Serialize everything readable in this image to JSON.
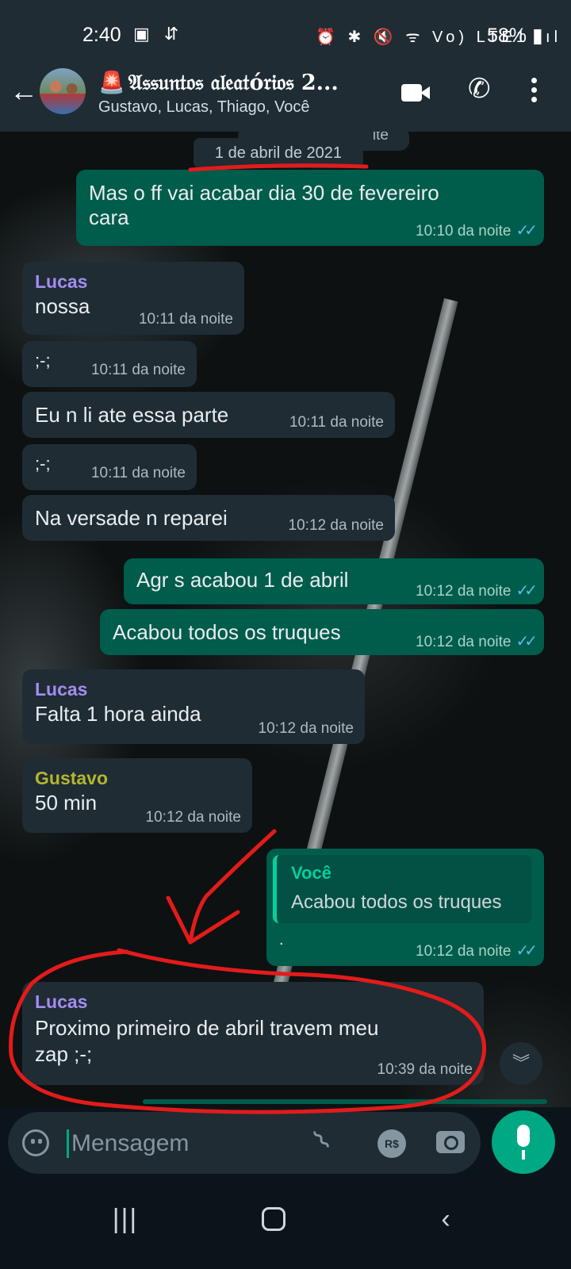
{
  "status": {
    "time": "2:40",
    "left_icons": "▣ ⇵",
    "right_icons": "⏰ ✱ 🔇 ᯤ Vo) LTE1 .ıl",
    "battery": "58% ▮"
  },
  "header": {
    "title_icon": "🚨",
    "title": "𝔄𝔰𝔰𝔲𝔫𝔱𝔬𝔰 𝔞𝔩𝔢𝔞𝔱ó𝔯𝔦𝔬𝔰 2...",
    "subtitle": "Gustavo, Lucas, Thiago, Você",
    "icons": [
      "back-arrow-icon",
      "group-avatar",
      "video-call-icon",
      "phone-icon",
      "more-options-icon"
    ]
  },
  "chat": {
    "date_chip": "1 de abril de 2021",
    "hidden_peek": "ite",
    "messages": [
      {
        "dir": "out",
        "text_line1": "Mas o ff vai acabar dia 30 de fevereiro",
        "text_line2": "cara",
        "time": "10:10 da noite",
        "ticks": "✓✓"
      },
      {
        "dir": "in",
        "sender": "Lucas",
        "text": "nossa",
        "time": "10:11 da noite"
      },
      {
        "dir": "in",
        "text": ";-;",
        "time": "10:11 da noite"
      },
      {
        "dir": "in",
        "text": "Eu n li ate essa parte",
        "time": "10:11 da noite"
      },
      {
        "dir": "in",
        "text": ";-;",
        "time": "10:11 da noite"
      },
      {
        "dir": "in",
        "text": "Na versade n reparei",
        "time": "10:12 da noite"
      },
      {
        "dir": "out",
        "text": "Agr s acabou 1 de abril",
        "time": "10:12 da noite",
        "ticks": "✓✓"
      },
      {
        "dir": "out",
        "text": "Acabou todos os truques",
        "time": "10:12 da noite",
        "ticks": "✓✓"
      },
      {
        "dir": "in",
        "sender": "Lucas",
        "text": "Falta 1 hora ainda",
        "time": "10:12 da noite"
      },
      {
        "dir": "in",
        "sender": "Gustavo",
        "text": "50 min",
        "time": "10:12 da noite"
      },
      {
        "dir": "out",
        "quote_name": "Você",
        "quote_text": "Acabou todos os truques",
        "text": ".",
        "time": "10:12 da noite",
        "ticks": "✓✓"
      },
      {
        "dir": "in",
        "sender": "Lucas",
        "text_line1": "Proximo primeiro de abril travem meu",
        "text_line2": "zap ;-;",
        "time": "10:39 da noite"
      }
    ],
    "scroll_down_icon": "︾"
  },
  "colors": {
    "lucas": "#a48cf0",
    "gustavo": "#b5b531",
    "annotation_red": "#e31b1b",
    "accent": "#00a884"
  },
  "composer": {
    "placeholder": "Mensagem",
    "rs_label": "R$"
  },
  "navbar": {
    "recent": "|||",
    "back": "‹"
  }
}
